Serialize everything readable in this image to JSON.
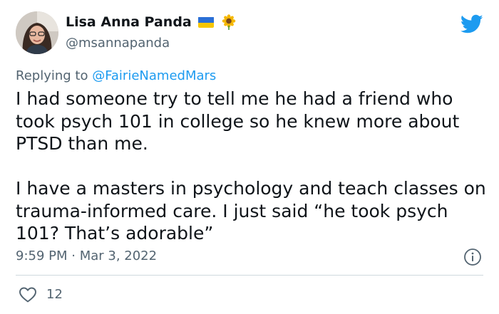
{
  "author": {
    "display_name": "Lisa Anna Panda",
    "handle": "@msannapanda",
    "name_emojis": [
      "ukraine-flag",
      "sunflower"
    ]
  },
  "reply": {
    "prefix": "Replying to ",
    "mention": "@FairieNamedMars"
  },
  "tweet": {
    "paragraphs": [
      "I had someone try to tell me he had a friend who took psych 101 in college so he knew more about PTSD than me.",
      "I have a masters in psychology and teach classes on trauma-informed care. I just said “he took psych 101? That’s adorable”"
    ],
    "timestamp": "9:59 PM · Mar 3, 2022"
  },
  "stats": {
    "likes": "12"
  },
  "colors": {
    "text": "#0f1419",
    "secondary": "#536471",
    "accent": "#1d9bf0",
    "divider": "#cfd9de"
  }
}
